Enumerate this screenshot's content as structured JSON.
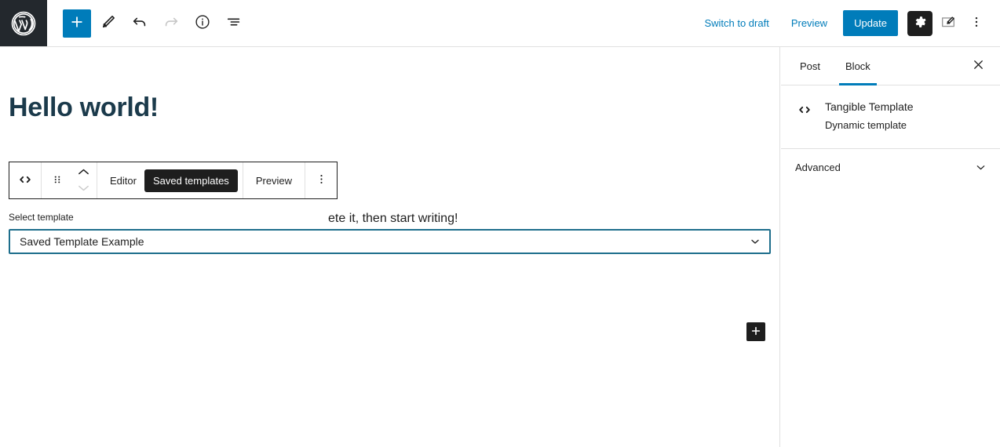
{
  "topbar": {
    "logo_icon": "wordpress-logo-icon",
    "tools": [
      {
        "name": "add-block-button",
        "icon": "plus-icon",
        "label": "Add block",
        "variant": "primary"
      },
      {
        "name": "edit-tool-button",
        "icon": "pencil-icon",
        "label": "Tools",
        "variant": "plain"
      },
      {
        "name": "undo-button",
        "icon": "undo-arrow-icon",
        "label": "Undo",
        "variant": "plain"
      },
      {
        "name": "redo-button",
        "icon": "redo-arrow-icon",
        "label": "Redo",
        "variant": "disabled"
      },
      {
        "name": "details-button",
        "icon": "info-circle-icon",
        "label": "Details",
        "variant": "plain"
      },
      {
        "name": "list-view-button",
        "icon": "list-view-icon",
        "label": "List view",
        "variant": "plain"
      }
    ],
    "switch_to_draft_label": "Switch to draft",
    "preview_label": "Preview",
    "update_label": "Update",
    "settings_icon": "gear-icon",
    "pencil_box_icon": "pencil-square-icon",
    "more_icon": "kebab-menu-icon",
    "accent_color": "#007cba"
  },
  "editor": {
    "post_title": "Hello world!",
    "paragraph_visible_text": "ete it, then start writing!",
    "title_color": "#1b3a4b",
    "appender_icon": "plus-icon",
    "block_toolbar": {
      "block_type_icon": "code-brackets-icon",
      "drag_icon": "drag-handle-icon",
      "move_up_icon": "chevron-up-icon",
      "move_down_icon": "chevron-down-icon",
      "tabs": [
        {
          "label": "Editor",
          "selected": false
        },
        {
          "label": "Saved templates",
          "selected": true
        }
      ],
      "preview_label": "Preview",
      "more_icon": "kebab-menu-icon"
    },
    "select_control": {
      "label": "Select template",
      "value": "Saved Template Example",
      "chevron_icon": "chevron-down-icon",
      "border_color": "#1e6e8c",
      "options": [
        "Saved Template Example"
      ]
    }
  },
  "sidebar": {
    "tabs": [
      {
        "label": "Post",
        "active": false
      },
      {
        "label": "Block",
        "active": true
      }
    ],
    "close_icon": "close-x-icon",
    "block_card": {
      "icon": "code-brackets-icon",
      "name": "Tangible Template",
      "description": "Dynamic template"
    },
    "panels": [
      {
        "label": "Advanced",
        "chevron_icon": "chevron-down-icon",
        "expanded": false
      }
    ],
    "active_underline_color": "#007cba"
  }
}
